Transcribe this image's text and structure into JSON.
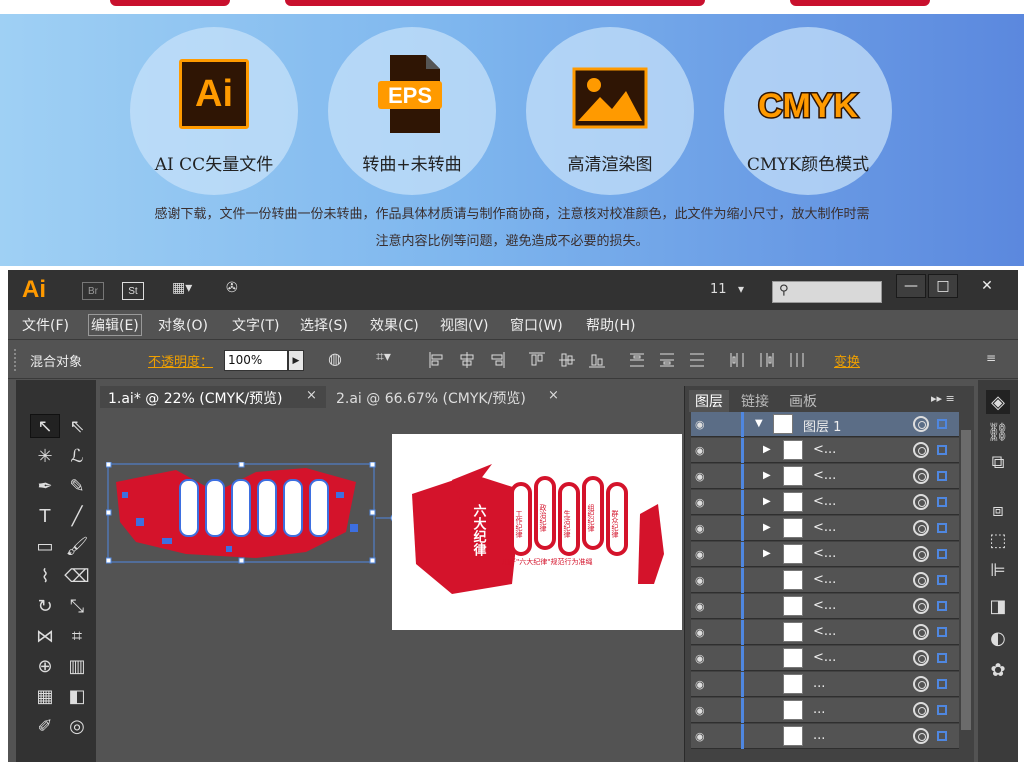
{
  "colors": {
    "accent_red": "#c8102e",
    "illustrator_orange": "#ff9a00",
    "layer_blue": "#4f87e0"
  },
  "promo": {
    "features": [
      {
        "icon": "ai-file-icon",
        "icon_text": "Ai",
        "label": "AI CC矢量文件"
      },
      {
        "icon": "eps-file-icon",
        "icon_text": "EPS",
        "label": "转曲+未转曲"
      },
      {
        "icon": "image-icon",
        "label": "高清渲染图"
      },
      {
        "icon": "cmyk-icon",
        "icon_text": "CMYK",
        "label": "CMYK颜色模式"
      }
    ],
    "note_line1": "感谢下载，文件一份转曲一份未转曲，作品具体材质请与制作商协商，注意核对校准颜色，此文件为缩小尺寸，放大制作时需",
    "note_line2": "注意内容比例等问题，避免造成不必要的损失。"
  },
  "app": {
    "logo": "Ai",
    "titlebar": {
      "br": "Br",
      "st": "St",
      "font_size_value": "11"
    },
    "menus": [
      "文件(F)",
      "编辑(E)",
      "对象(O)",
      "文字(T)",
      "选择(S)",
      "效果(C)",
      "视图(V)",
      "窗口(W)",
      "帮助(H)"
    ],
    "active_menu_index": 1,
    "control": {
      "mode_label": "混合对象",
      "opacity_label": "不透明度：",
      "opacity_value": "100%",
      "transform_label": "变换"
    },
    "doc_tabs": [
      {
        "label": "1.ai* @ 22% (CMYK/预览)",
        "active": true
      },
      {
        "label": "2.ai @ 66.67% (CMYK/预览)",
        "active": false
      }
    ],
    "panel": {
      "tabs": [
        "图层",
        "链接",
        "画板"
      ],
      "layer_top": "图层 1",
      "rows": [
        {
          "name": "<...",
          "expandable": true
        },
        {
          "name": "<...",
          "expandable": true
        },
        {
          "name": "<...",
          "expandable": true
        },
        {
          "name": "<...",
          "expandable": true
        },
        {
          "name": "<...",
          "expandable": true
        },
        {
          "name": "<...",
          "expandable": false
        },
        {
          "name": "<...",
          "expandable": false
        },
        {
          "name": "<...",
          "expandable": false
        },
        {
          "name": "<...",
          "expandable": false
        },
        {
          "name": "...",
          "expandable": false
        },
        {
          "name": "...",
          "expandable": false
        },
        {
          "name": "...",
          "expandable": false
        }
      ]
    },
    "artboard_art": {
      "title": "六大纪律",
      "pillars": [
        "政治纪律",
        "组织纪律",
        "廉洁纪律",
        "群众纪律",
        "工作纪律",
        "生活纪律"
      ],
      "slogan": "用严\"六大纪律\"规范行为准绳"
    }
  }
}
